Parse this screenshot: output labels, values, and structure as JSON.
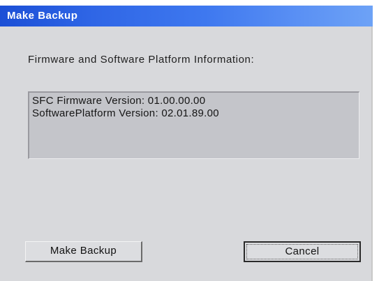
{
  "window": {
    "title": "Make Backup"
  },
  "content": {
    "section_label": "Firmware and Software Platform Information:",
    "info_lines": [
      "SFC Firmware Version: 01.00.00.00",
      "SoftwarePlatform Version: 02.01.89.00"
    ]
  },
  "buttons": {
    "make_backup_label": "Make Backup",
    "cancel_label": "Cancel"
  },
  "colors": {
    "titlebar_start": "#1b4fd6",
    "titlebar_end": "#6da2f6",
    "dialog_background": "#d8d9dc",
    "info_box_background": "#c4c5ca"
  }
}
